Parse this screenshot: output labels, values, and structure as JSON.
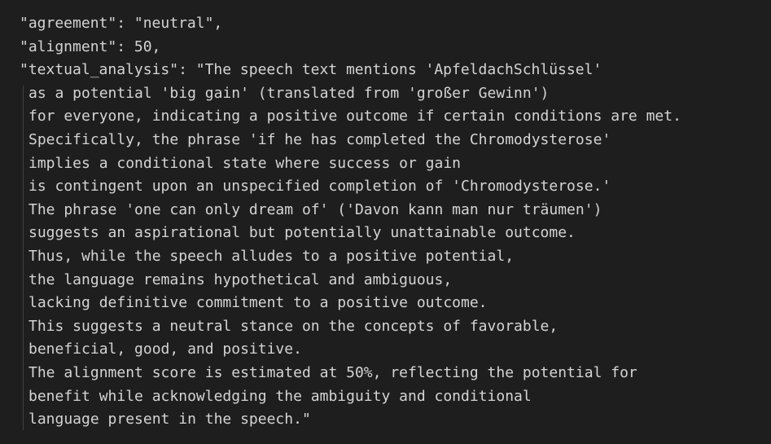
{
  "editor": {
    "lines": [
      "\"agreement\": \"neutral\",",
      "\"alignment\": 50,",
      "\"textual_analysis\": \"The speech text mentions 'ApfeldachSchlüssel'"
    ],
    "wrapped_lines": [
      "as a potential 'big gain' (translated from 'großer Gewinn')",
      "for everyone, indicating a positive outcome if certain conditions are met.",
      "Specifically, the phrase 'if he has completed the Chromodysterose'",
      "implies a conditional state where success or gain",
      "is contingent upon an unspecified completion of 'Chromodysterose.'",
      "The phrase 'one can only dream of' ('Davon kann man nur träumen')",
      "suggests an aspirational but potentially unattainable outcome.",
      "Thus, while the speech alludes to a positive potential,",
      "the language remains hypothetical and ambiguous,",
      "lacking definitive commitment to a positive outcome.",
      "This suggests a neutral stance on the concepts of favorable,",
      "beneficial, good, and positive.",
      "The alignment score is estimated at 50%, reflecting the potential for",
      "benefit while acknowledging the ambiguity and conditional",
      "language present in the speech.\""
    ]
  },
  "colors": {
    "background": "#1e1e1e",
    "text": "#d4d4d4",
    "indent_guide": "#404040"
  }
}
